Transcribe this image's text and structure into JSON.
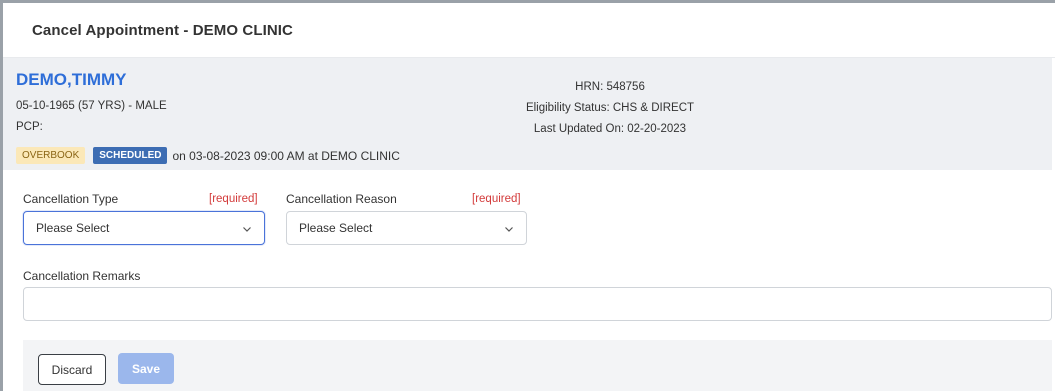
{
  "dialog": {
    "title": "Cancel Appointment - DEMO CLINIC"
  },
  "patient": {
    "name": "DEMO,TIMMY",
    "dob_line": "05-10-1965 (57 YRS) - MALE",
    "pcp": "PCP:",
    "hrn": "HRN: 548756",
    "eligibility": "Eligibility Status: CHS & DIRECT",
    "last_updated": "Last Updated On: 02-20-2023",
    "badges": {
      "overbook": "OVERBOOK",
      "scheduled": "SCHEDULED"
    },
    "appointment_text": "on 03-08-2023 09:00 AM at DEMO CLINIC"
  },
  "form": {
    "cancellation_type": {
      "label": "Cancellation Type",
      "required": "[required]",
      "value": "Please Select"
    },
    "cancellation_reason": {
      "label": "Cancellation Reason",
      "required": "[required]",
      "value": "Please Select"
    },
    "remarks": {
      "label": "Cancellation Remarks",
      "value": ""
    }
  },
  "footer": {
    "discard_label": "Discard",
    "save_label": "Save"
  },
  "colors": {
    "name_blue": "#2e6ed8",
    "required_red": "#d33b3b",
    "scheduled_badge": "#3d6db3",
    "overbook_badge": "#fbe8b8",
    "save_disabled": "#9bb7ec"
  },
  "icons": {
    "select_arrow": "chevron-down-icon"
  }
}
